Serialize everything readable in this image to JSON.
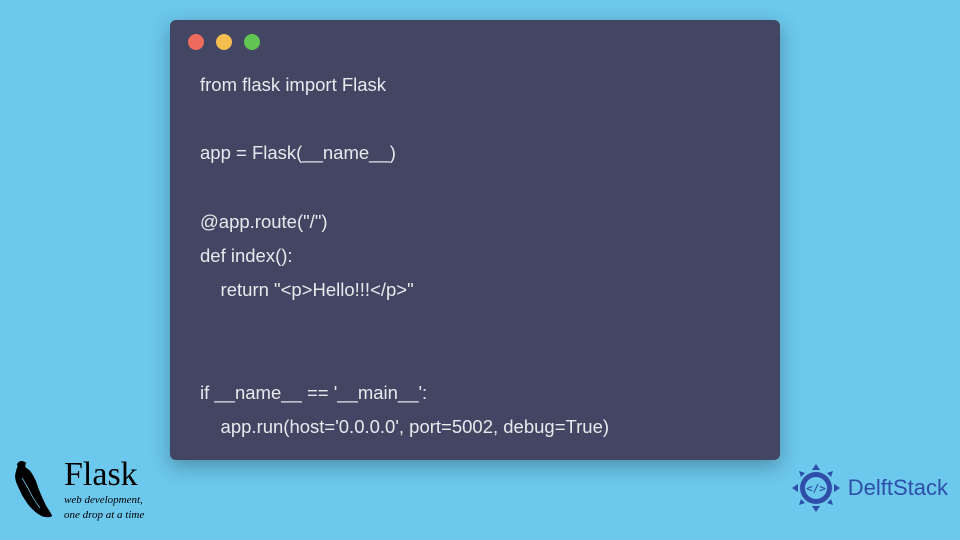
{
  "code": {
    "lines": [
      "from flask import Flask",
      "",
      "app = Flask(__name__)",
      "",
      "@app.route(\"/\")",
      "def index():",
      "    return \"<p>Hello!!!</p>\"",
      "",
      "",
      "if __name__ == '__main__':",
      "    app.run(host='0.0.0.0', port=5002, debug=True)"
    ]
  },
  "flask_logo": {
    "title": "Flask",
    "subtitle_line1": "web development,",
    "subtitle_line2": "one drop at a time"
  },
  "delft_logo": {
    "text": "DelftStack"
  },
  "colors": {
    "background": "#6cc8ed",
    "code_window": "#434662",
    "code_text": "#e8e9ee",
    "dot_red": "#ed6a5e",
    "dot_yellow": "#f5be4f",
    "dot_green": "#61c554",
    "delft_blue": "#2e4fa8"
  }
}
